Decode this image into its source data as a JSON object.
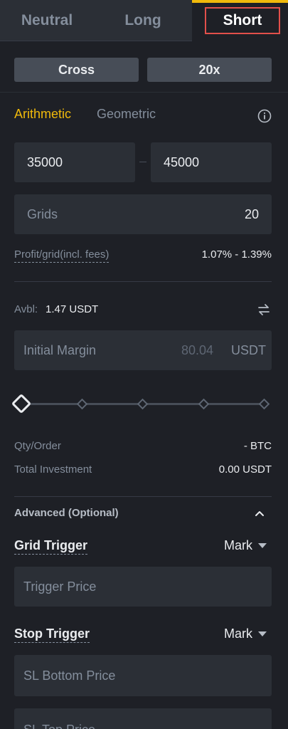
{
  "tabs": {
    "neutral": "Neutral",
    "long": "Long",
    "short": "Short"
  },
  "margin_mode": "Cross",
  "leverage": "20x",
  "price_mode": {
    "arithmetic": "Arithmetic",
    "geometric": "Geometric",
    "selected": "Arithmetic"
  },
  "price_range": {
    "lower": "35000",
    "upper": "45000"
  },
  "grids": {
    "label": "Grids",
    "value": "20"
  },
  "profit_per_grid": {
    "label": "Profit/grid(incl. fees)",
    "value": "1.07% - 1.39%"
  },
  "available": {
    "label": "Avbl:",
    "value": "1.47 USDT"
  },
  "initial_margin": {
    "placeholder": "Initial Margin",
    "value": "80.04",
    "unit": "USDT"
  },
  "slider": {
    "level": 0
  },
  "qty_per_order": {
    "label": "Qty/Order",
    "value": "- BTC"
  },
  "total_investment": {
    "label": "Total Investment",
    "value": "0.00 USDT"
  },
  "advanced": {
    "label": "Advanced (Optional)"
  },
  "grid_trigger": {
    "label": "Grid Trigger",
    "type": "Mark",
    "placeholder": "Trigger Price"
  },
  "stop_trigger": {
    "label": "Stop Trigger",
    "type": "Mark",
    "sl_bottom_placeholder": "SL Bottom Price",
    "sl_top_placeholder": "SL Top Price"
  },
  "colors": {
    "accent": "#f0b90b",
    "highlight_border": "#e2504b",
    "bg": "#1e2026",
    "field_bg": "#2b2f36"
  }
}
